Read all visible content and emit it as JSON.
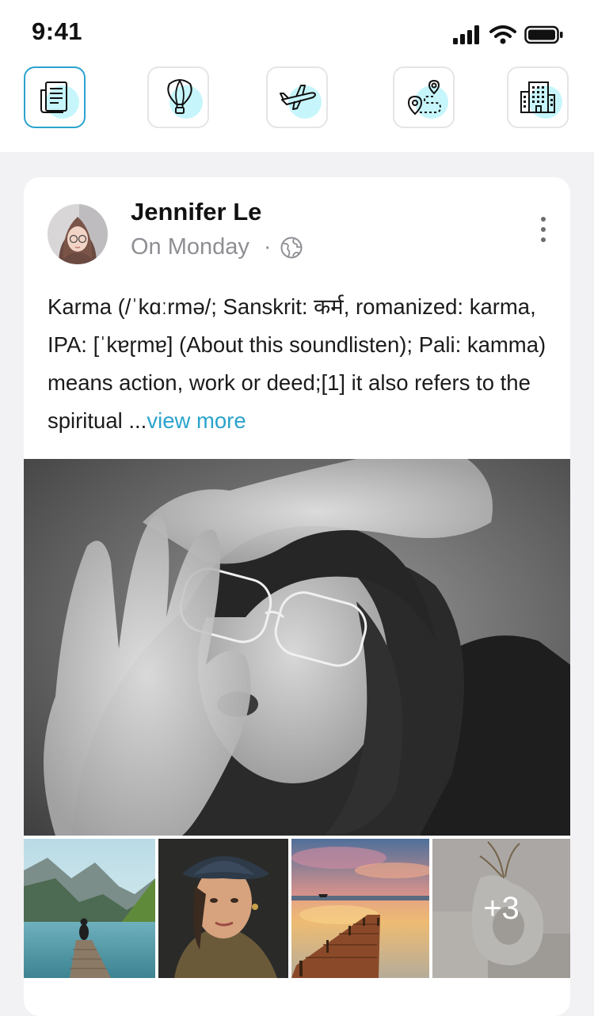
{
  "status_bar": {
    "time": "9:41"
  },
  "categories": [
    {
      "icon": "newspaper-icon",
      "active": true
    },
    {
      "icon": "hot-air-balloon-icon",
      "active": false
    },
    {
      "icon": "airplane-icon",
      "active": false
    },
    {
      "icon": "route-map-icon",
      "active": false
    },
    {
      "icon": "building-icon",
      "active": false
    }
  ],
  "post": {
    "author": "Jennifer Le",
    "time": "On Monday",
    "separator": "·",
    "privacy_icon": "globe-icon",
    "text": "Karma (/ˈkɑːrmə/; Sanskrit: कर्म, romanized: karma, IPA: [ˈkɐɽmɐ] (About this soundlisten); Pali: kamma) means action, work or deed;[1] it also refers to the spiritual ...",
    "view_more": "view more",
    "more_photos": "+3"
  },
  "colors": {
    "accent": "#2aa3cc",
    "icon_blob": "#c6f6fb",
    "muted_text": "#8e8e93",
    "background": "#f2f2f4"
  }
}
